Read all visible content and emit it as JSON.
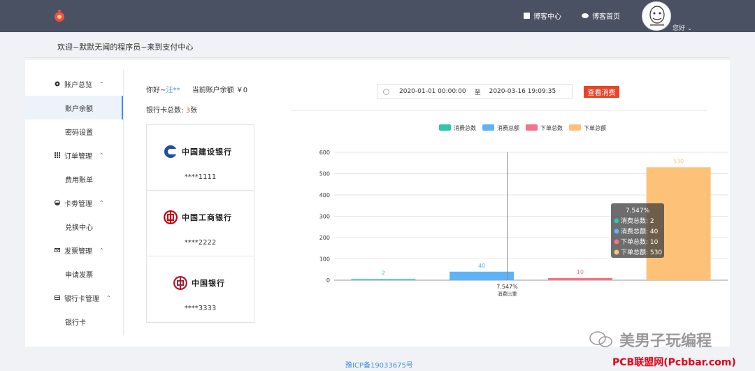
{
  "header": {
    "links": [
      "博客中心",
      "博客首页"
    ],
    "greeting": "您好",
    "brand_color": "#4a5163"
  },
  "welcome": "欢迎~默默无闻的程序员~来到支付中心",
  "sidebar": {
    "groups": [
      {
        "label": "账户总览",
        "icon": "dashboard-icon",
        "items": [
          "账户余额",
          "密码设置"
        ]
      },
      {
        "label": "订单管理",
        "icon": "grid-icon",
        "items": [
          "费用账单"
        ]
      },
      {
        "label": "卡劵管理",
        "icon": "coupon-icon",
        "items": [
          "兑换中心"
        ]
      },
      {
        "label": "发票管理",
        "icon": "mail-icon",
        "items": [
          "申请发票"
        ]
      },
      {
        "label": "银行卡管理",
        "icon": "card-icon",
        "items": [
          "银行卡"
        ]
      }
    ],
    "active_item": "账户余额"
  },
  "account": {
    "hello": "你好~",
    "name": "汪**",
    "balance_label": "当前账户余额",
    "balance": "￥0",
    "cards_label": "银行卡总数:",
    "cards_count": "3",
    "cards_unit": "张"
  },
  "cards": [
    {
      "bank": "中国建设银行",
      "number": "****1111",
      "color": "#1f4fa0"
    },
    {
      "bank": "中国工商银行",
      "number": "****2222",
      "color": "#c7000b"
    },
    {
      "bank": "中国银行",
      "number": "****3333",
      "color": "#a71e32"
    }
  ],
  "filter": {
    "start": "2020-01-01 00:00:00",
    "to": "至",
    "end": "2020-03-16 19:09:35",
    "button": "查看消费",
    "accent": "#e8442a"
  },
  "chart_data": {
    "type": "bar",
    "categories": [
      "消费比重"
    ],
    "category_extra_label": "7.547%",
    "series": [
      {
        "name": "消费总数",
        "values": [
          2
        ],
        "color": "#2ec7a8"
      },
      {
        "name": "消费总额",
        "values": [
          40
        ],
        "color": "#5fb2f5"
      },
      {
        "name": "下单总数",
        "values": [
          10
        ],
        "color": "#f4738a"
      },
      {
        "name": "下单总额",
        "values": [
          530
        ],
        "color": "#fec178"
      }
    ],
    "ylim": [
      0,
      600
    ],
    "yticks": [
      0,
      100,
      200,
      300,
      400,
      500,
      600
    ],
    "legend": "top-center",
    "grid": true,
    "tooltip": {
      "title": "7.547%",
      "rows": [
        "消费总数: 2",
        "消费总额: 40",
        "下单总数: 10",
        "下单总额: 530"
      ]
    }
  },
  "footer": {
    "icp": "豫ICP备19033675号",
    "watermark1": "美男子玩编程",
    "watermark2": "PCB联盟网(Pcbbar.com)"
  }
}
